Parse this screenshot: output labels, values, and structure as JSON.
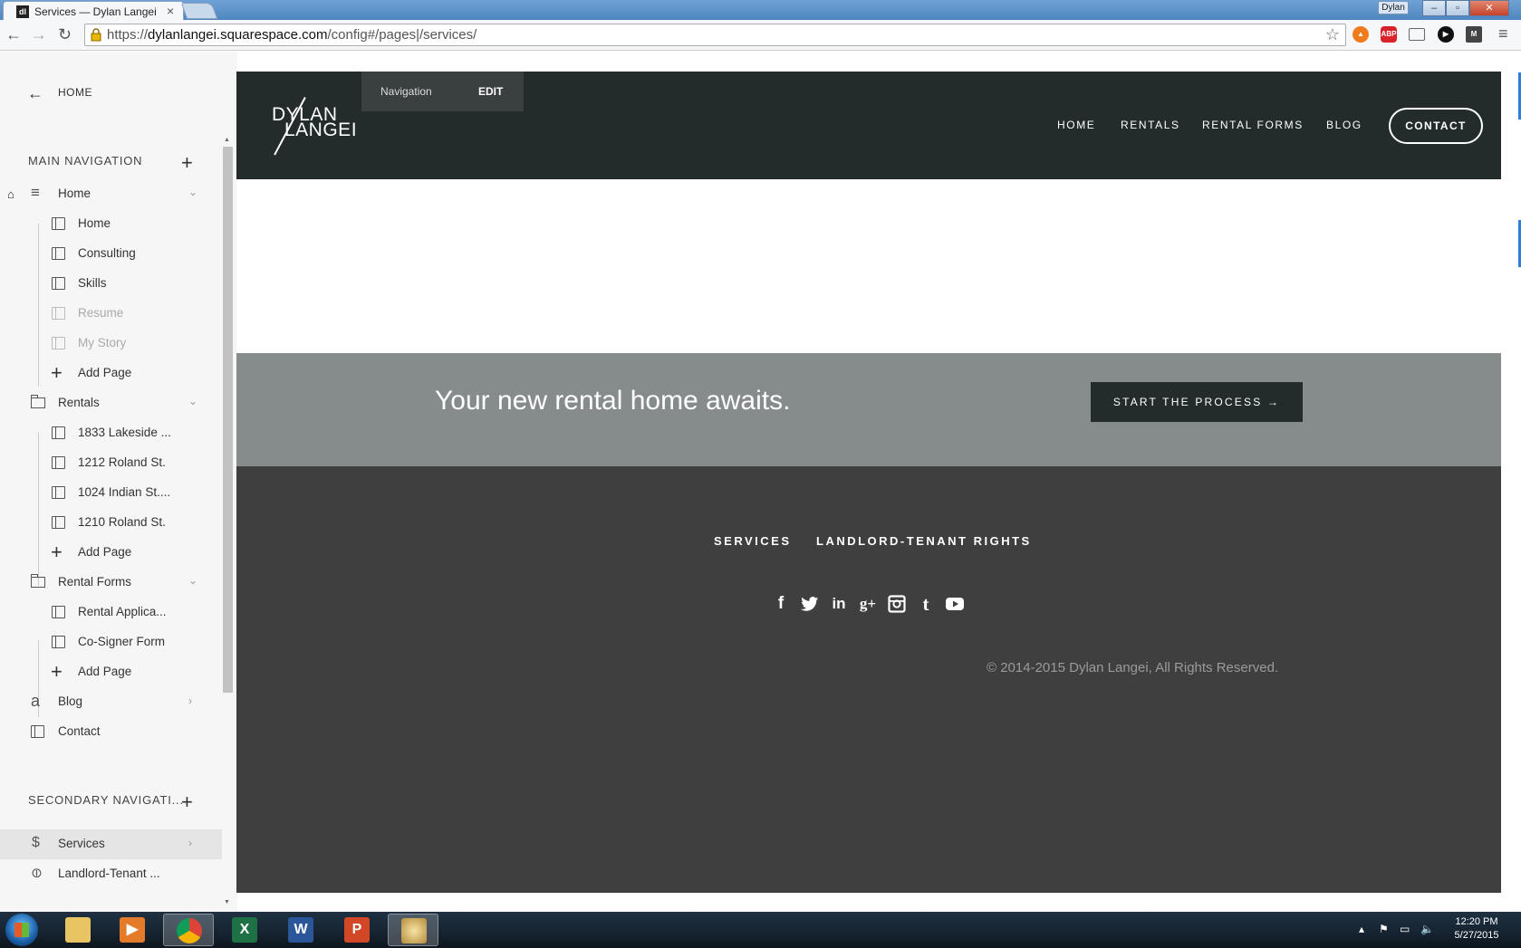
{
  "browser": {
    "tab_title": "Services — Dylan Langei",
    "favicon_text": "dl",
    "user_name": "Dylan",
    "url_scheme": "https://",
    "url_domain": "dylanlangei.squarespace.com",
    "url_path": "/config#/pages|/services/"
  },
  "sidebar": {
    "back_label": "HOME",
    "main_nav_title": "MAIN NAVIGATION",
    "secondary_nav_title": "SECONDARY NAVIGATI...",
    "items": [
      {
        "label": "Home",
        "kind": "index",
        "level": 0
      },
      {
        "label": "Home",
        "kind": "page",
        "level": 1
      },
      {
        "label": "Consulting",
        "kind": "page",
        "level": 1
      },
      {
        "label": "Skills",
        "kind": "page",
        "level": 1
      },
      {
        "label": "Resume",
        "kind": "page",
        "level": 1,
        "disabled": true
      },
      {
        "label": "My Story",
        "kind": "page",
        "level": 1,
        "disabled": true
      },
      {
        "label": "Add Page",
        "kind": "add",
        "level": 1
      },
      {
        "label": "Rentals",
        "kind": "folder",
        "level": 0
      },
      {
        "label": "1833 Lakeside ...",
        "kind": "page",
        "level": 1
      },
      {
        "label": "1212 Roland St.",
        "kind": "page",
        "level": 1
      },
      {
        "label": "1024 Indian St....",
        "kind": "page",
        "level": 1
      },
      {
        "label": "1210 Roland St.",
        "kind": "page",
        "level": 1
      },
      {
        "label": "Add Page",
        "kind": "add",
        "level": 1
      },
      {
        "label": "Rental Forms",
        "kind": "folder",
        "level": 0
      },
      {
        "label": "Rental Applica...",
        "kind": "page",
        "level": 1
      },
      {
        "label": "Co-Signer Form",
        "kind": "page",
        "level": 1
      },
      {
        "label": "Add Page",
        "kind": "add",
        "level": 1
      },
      {
        "label": "Blog",
        "kind": "blog",
        "level": 0
      },
      {
        "label": "Contact",
        "kind": "page",
        "level": 0
      }
    ],
    "secondary_items": [
      {
        "label": "Services",
        "icon": "dollar-icon",
        "selected": true
      },
      {
        "label": "Landlord-Tenant ...",
        "icon": "link-icon"
      }
    ]
  },
  "site": {
    "logo_top": "DYLAN",
    "logo_bottom": "LANGEI",
    "edit_overlay": {
      "navigation_label": "Navigation",
      "edit_label": "EDIT"
    },
    "nav": [
      "HOME",
      "RENTALS",
      "RENTAL FORMS",
      "BLOG"
    ],
    "contact_label": "CONTACT",
    "cta_text": "Your new rental home awaits.",
    "cta_button": "START THE PROCESS →",
    "footer_links": [
      "SERVICES",
      "LANDLORD-TENANT RIGHTS"
    ],
    "social_icons": [
      "facebook-icon",
      "twitter-icon",
      "linkedin-icon",
      "google-plus-icon",
      "instagram-icon",
      "tumblr-icon",
      "youtube-icon"
    ],
    "copyright": "© 2014-2015 Dylan Langei, All Rights Reserved."
  },
  "taskbar": {
    "apps": [
      "file-explorer-icon",
      "media-player-icon",
      "chrome-icon",
      "excel-icon",
      "word-icon",
      "powerpoint-icon",
      "paint-icon"
    ],
    "time": "12:20 PM",
    "date": "5/27/2015"
  },
  "colors": {
    "header_bg": "#232b2b",
    "cta_bg": "#868b8b",
    "footer_bg": "#3f3f3f",
    "sidebar_bg": "#f6f6f6"
  }
}
